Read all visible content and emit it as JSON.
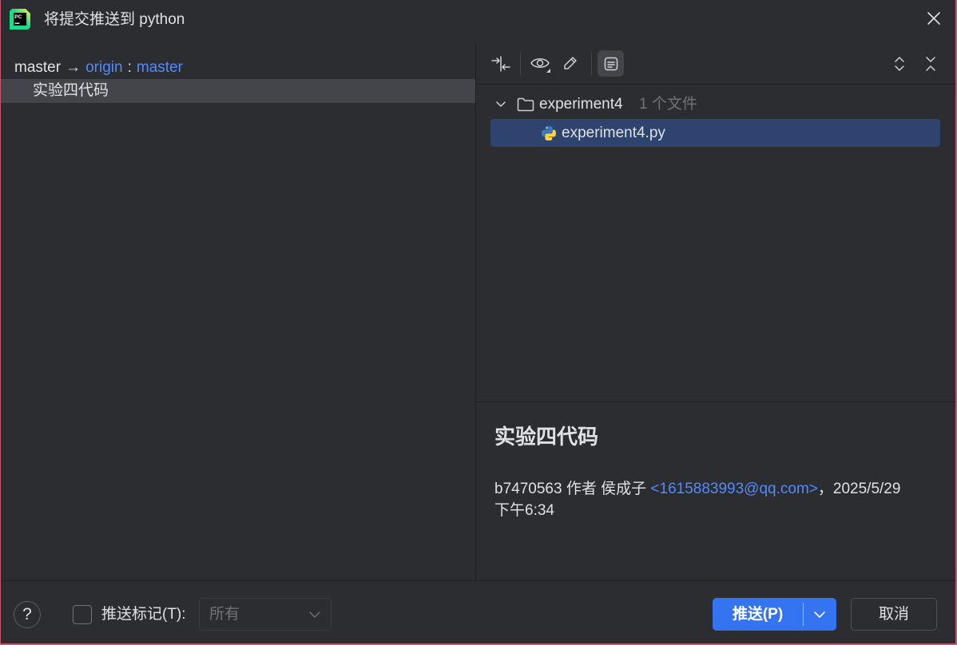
{
  "window": {
    "title": "将提交推送到 python",
    "logo_text": "PC"
  },
  "left_panel": {
    "branch": {
      "local": "master",
      "arrow": "→",
      "remote": "origin",
      "separator": ":",
      "remote_branch": "master"
    },
    "commits": [
      {
        "message": "实验四代码",
        "selected": true
      }
    ]
  },
  "toolbar": {
    "left_icons": [
      "show-diff-icon",
      "eye-icon",
      "edit-pencil-icon",
      "commit-details-icon"
    ],
    "right_icons": [
      "expand-all-icon",
      "collapse-all-icon"
    ],
    "active_icon": "commit-details-icon"
  },
  "changes_tree": {
    "folder": {
      "name": "experiment4",
      "file_count": "1 个文件",
      "expanded": true
    },
    "files": [
      {
        "name": "experiment4.py",
        "icon": "python-file-icon",
        "selected": true
      }
    ]
  },
  "commit_details": {
    "subject": "实验四代码",
    "hash": "b7470563",
    "author_label": "作者",
    "author": "侯成子",
    "email": "<1615883993@qq.com>",
    "separator": "，",
    "date": "2025/5/29",
    "time": "下午6:34"
  },
  "footer": {
    "help_label": "?",
    "push_tags_label": "推送标记(T):",
    "push_tags_checked": false,
    "tags_option": "所有",
    "tags_option_enabled": false,
    "push_button_label": "推送(P)",
    "cancel_button_label": "取消"
  },
  "colors": {
    "background": "#2b2d30",
    "text": "#dfe1e5",
    "muted_text": "#6f737a",
    "link": "#548af7",
    "accent": "#3574f0",
    "row_selected": "#43454a",
    "file_selected": "#2e436e",
    "window_border": "#c9546d"
  }
}
